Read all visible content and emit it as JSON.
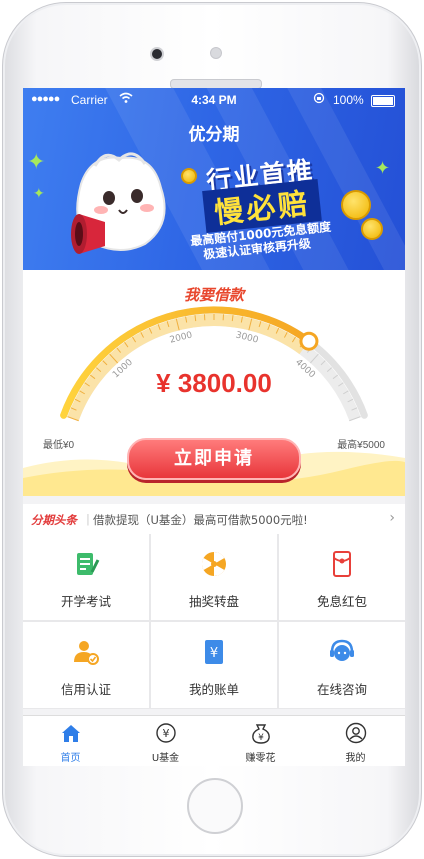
{
  "status_bar": {
    "signal_dots": "●●●●●",
    "carrier": "Carrier",
    "time": "4:34 PM",
    "battery": "100%"
  },
  "banner": {
    "title": "优分期",
    "line1": "行业首推",
    "line2": "慢必赔",
    "line3": "最高赔付1000元免息额度",
    "line4": "极速认证审核再升级"
  },
  "loan": {
    "heading": "我要借款",
    "amount": "¥ 3800.00",
    "min_label": "最低¥0",
    "max_label": "最高¥5000",
    "ticks": [
      "1000",
      "2000",
      "3000",
      "4000"
    ],
    "apply_label": "立即申请",
    "slider_value": 3800,
    "slider_min": 0,
    "slider_max": 5000
  },
  "news": {
    "tag": "分期头条",
    "separator": "|",
    "text": "借款提现（U基金）最高可借款5000元啦!",
    "arrow": "›"
  },
  "grid": [
    {
      "label": "开学考试",
      "icon": "exam-icon",
      "color": "#3dbb6b"
    },
    {
      "label": "抽奖转盘",
      "icon": "lottery-wheel-icon",
      "color": "#f5a623"
    },
    {
      "label": "免息红包",
      "icon": "red-packet-icon",
      "color": "#e8403a"
    },
    {
      "label": "信用认证",
      "icon": "credit-auth-icon",
      "color": "#f5a623"
    },
    {
      "label": "我的账单",
      "icon": "bill-icon",
      "color": "#3d8be8"
    },
    {
      "label": "在线咨询",
      "icon": "customer-service-icon",
      "color": "#3d8be8"
    }
  ],
  "tabbar": [
    {
      "label": "首页",
      "icon": "home-icon",
      "active": true
    },
    {
      "label": "U基金",
      "icon": "yen-fund-icon",
      "glyph": "¥",
      "active": false
    },
    {
      "label": "赚零花",
      "icon": "money-bag-icon",
      "glyph": "¥",
      "active": false
    },
    {
      "label": "我的",
      "icon": "profile-icon",
      "active": false
    }
  ],
  "colors": {
    "accent": "#2f7ee8",
    "brand_blue": "#2f67e6",
    "apply_red": "#e8363b",
    "amount_red": "#e8332d",
    "gauge_orange": "#f5a623"
  }
}
